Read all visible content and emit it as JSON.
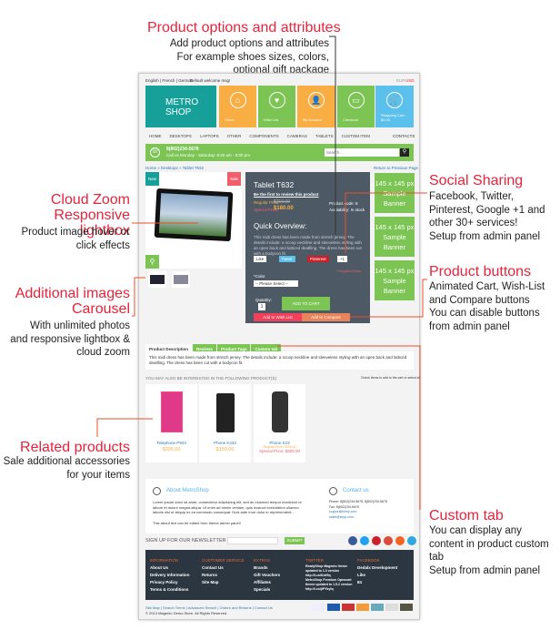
{
  "annotations": {
    "options": {
      "title": "Product options and attributes",
      "lines": [
        "Add product options and attributes",
        "For example shoes sizes, colors,",
        "optional gift package"
      ]
    },
    "social": {
      "title": "Social Sharing",
      "lines": [
        "Facebook, Twitter,",
        "Pinterest, Google +1 and",
        "other 30+ services!",
        "Setup from admin panel"
      ]
    },
    "zoom": {
      "title": [
        "Cloud Zoom",
        "Responsive lightbox"
      ],
      "lines": [
        "Product image hover or",
        "click effects"
      ]
    },
    "carousel": {
      "title": [
        "Additional images",
        "Carousel"
      ],
      "lines": [
        "With unlimited photos",
        "and responsive lightbox &",
        "cloud zoom"
      ]
    },
    "buttons": {
      "title": "Product buttons",
      "lines": [
        "Animated Cart, Wish-List",
        "and Compare buttons",
        "You can disable buttons",
        "from admin panel"
      ]
    },
    "related": {
      "title": "Related products",
      "lines": [
        "Sale additional accessories",
        "for your items"
      ]
    },
    "customtab": {
      "title": "Custom tab",
      "lines": [
        "You can display any",
        "content in product custom",
        "tab",
        "Setup from admin panel"
      ]
    }
  },
  "topbar": {
    "langs": "English | French | German",
    "welcome": "Default welcome msg!",
    "cur1": "EUR",
    "cur2": "USD"
  },
  "header": {
    "logo": "METRO SHOP",
    "tiles": [
      {
        "label": "Home",
        "icon": "home-icon",
        "glyph": "⌂"
      },
      {
        "label": "Wish List",
        "icon": "heart-icon",
        "glyph": "♥"
      },
      {
        "label": "My Account",
        "icon": "user-icon",
        "glyph": "👤"
      },
      {
        "label": "Checkout",
        "icon": "card-icon",
        "glyph": "▭"
      },
      {
        "label": "Shopping Cart - $0.00",
        "icon": "cart-icon",
        "glyph": "🛒"
      }
    ]
  },
  "nav": [
    "HOME",
    "DESKTOPS",
    "LAPTOPS",
    "OTHER",
    "COMPONENTS",
    "CAMERAS",
    "TABLETS",
    "CUSTOM ITEM"
  ],
  "nav_contacts": "CONTACTS",
  "callbar": {
    "phone": "8(802)234-5678",
    "hours": "Call us Monday - Saturday: 8:30 am - 6:00 pm",
    "search_placeholder": "Search..."
  },
  "breadcrumb": {
    "path": "Home » Desktops » Tablet T632",
    "back": "Return to Previous Page"
  },
  "product": {
    "badge_new": "New",
    "badge_sale": "Sale",
    "name": "Tablet T632",
    "review": "Be the first to review this product",
    "regular_label": "Regular Price:",
    "regular": "$219.00",
    "special_label": "Special Price:",
    "special": "$180.00",
    "code": "Product code: 8",
    "availability": "Availability: In stock",
    "overview_title": "Quick Overview:",
    "overview": "This midi dress has been made from stretch jersey. The details include: a scoop neckline and sleeveless styling with an open back and latticed deatlling. The dress has been cut with a bodycon fit.",
    "share": [
      "Like",
      "Tweet",
      "Pinterest",
      "+1"
    ],
    "required": "* Required Fields",
    "color_label": "*Color",
    "color_value": "-- Please Select --",
    "qty_label": "Quantity:",
    "qty": "1",
    "add_to_cart": "ADD TO CART",
    "wishlist": "Add to Wish List",
    "compare": "Add to Compare"
  },
  "banners": [
    "145 x 145 px Sample Banner",
    "145 x 145 px Sample Banner",
    "145 x 145 px Sample Banner"
  ],
  "tabs": [
    "Product Description",
    "Reviews",
    "Product Tags",
    "Custom tab"
  ],
  "description": "This midi dress has been made from stretch jersey. The details include: a scoop neckline and sleeveless styling with an open back and latticed deatlling. The dress has been cut with a bodycon fit.",
  "related": {
    "heading": "YOU MAY ALSO BE INTERESTED IN THE FOLLOWING PRODUCT(S)",
    "hint": "Check items to add to the cart or select all",
    "items": [
      {
        "name": "Telephone P923",
        "price": "$205.00"
      },
      {
        "name": "Phone K432",
        "price": "$150.00"
      },
      {
        "name": "Phone K23",
        "regular": "Regular Price: $325.00",
        "price": "Special Price: $305.00"
      }
    ]
  },
  "about": {
    "title": "About MetroShop",
    "text": "Lorem ipsum dolor sit amet, consectetur adipisicing elit, sed do eiusmod tempor incididunt ut labore et dolore magna aliqua. Ut enim ad minim veniam, quis nostrud exercitation ullamco laboris nisi ut aliquip ex ea commodo consequat. Duis aute irure dolor in reprehenderit...",
    "note": "This about text can be edited from theme admin panel!",
    "contact_title": "Contact us",
    "phone": "Phone: 8(802)234-5678, 8(802)234-5678",
    "fax": "Fax: 8(802)234-5678",
    "email1": "support@shop.com",
    "email2": "sales@shop.com"
  },
  "newsletter": {
    "label": "SIGN UP FOR OUR NEWSLETTER",
    "submit": "SUBMIT"
  },
  "social_colors": [
    "#3b5998",
    "#1da1f2",
    "#cb2027",
    "#dd4b39",
    "#f26522",
    "#2fa8e0"
  ],
  "footer": {
    "cols": [
      {
        "h": "INFORMATION",
        "items": [
          "About Us",
          "Delivery Information",
          "Privacy Policy",
          "Terms & Conditions"
        ]
      },
      {
        "h": "CUSTOMER SERVICE",
        "items": [
          "Contact Us",
          "Returns",
          "Site Map"
        ]
      },
      {
        "h": "EXTRAS",
        "items": [
          "Brands",
          "Gift Vouchers",
          "Affiliates",
          "Specials"
        ]
      },
      {
        "h": "TWITTER",
        "items": [
          "ReadyShop Magento theme updated to 1.3 version",
          "http://t.co/Kizfflq",
          "MetroShop Premium Opencart theme updated to 1.5.2 version",
          "http://t.co/jlPYkyfq"
        ]
      },
      {
        "h": "FACEBOOK",
        "items": [
          "Dedalx Development",
          "Like",
          "84"
        ]
      }
    ],
    "links": "Site Map | Search Terms | Advanced Search | Orders and Returns | Contact Us",
    "copyright": "© 2013 Magento Demo Store. All Rights Reserved."
  }
}
